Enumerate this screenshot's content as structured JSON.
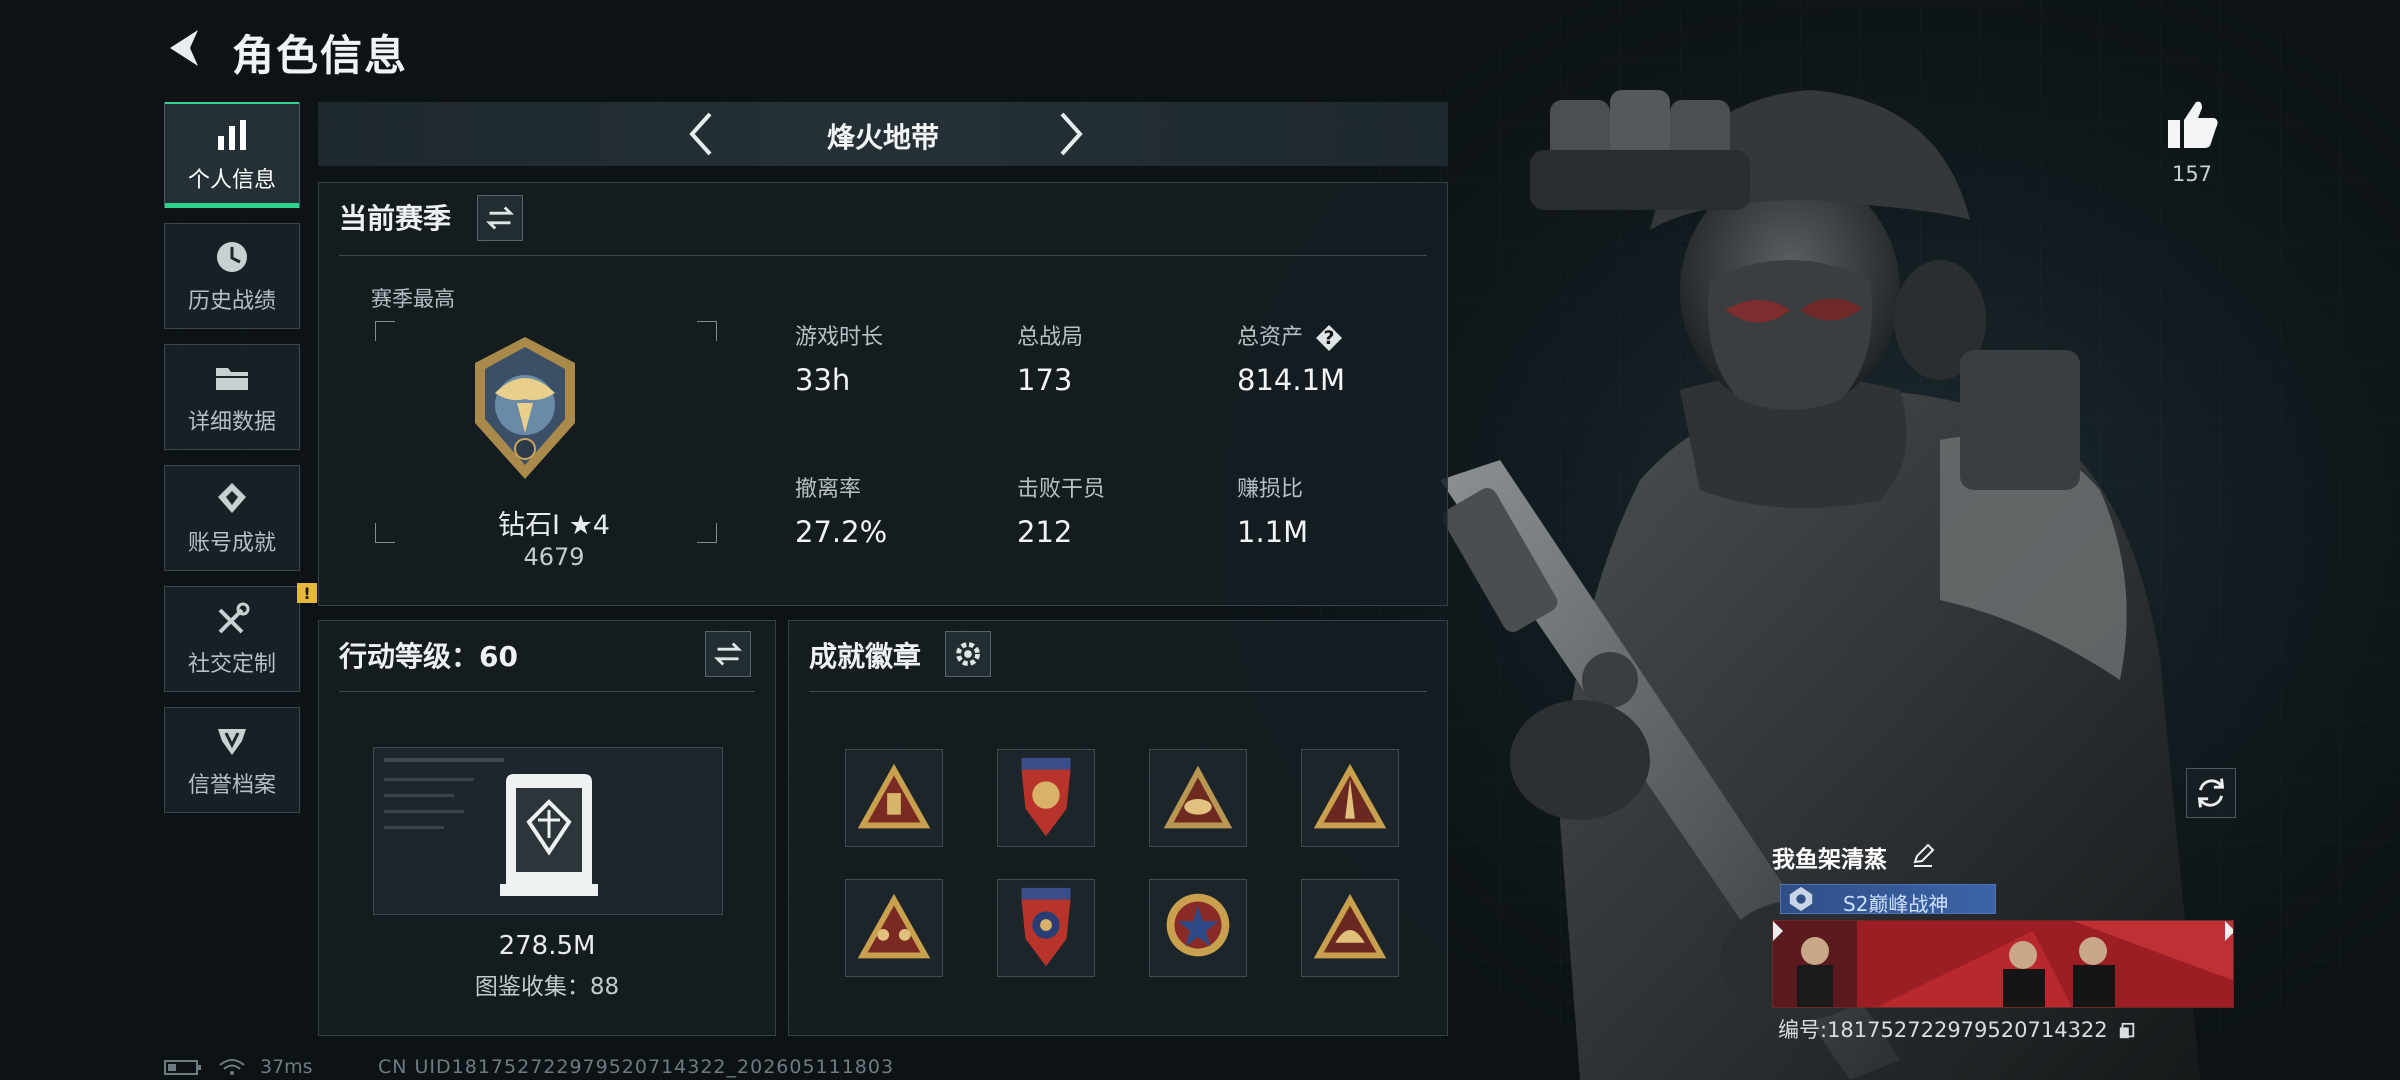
{
  "header": {
    "title": "角色信息"
  },
  "sidebar": {
    "items": [
      {
        "label": "个人信息",
        "icon": "bar-chart-icon",
        "active": true
      },
      {
        "label": "历史战绩",
        "icon": "clock-icon"
      },
      {
        "label": "详细数据",
        "icon": "folder-icon"
      },
      {
        "label": "账号成就",
        "icon": "diamond-icon"
      },
      {
        "label": "社交定制",
        "icon": "wrench-icon",
        "badge": "!"
      },
      {
        "label": "信誉档案",
        "icon": "shield-icon"
      }
    ]
  },
  "mode": {
    "title": "烽火地带"
  },
  "season": {
    "title": "当前赛季",
    "best_label": "赛季最高",
    "rank_name": "钻石I ★4",
    "rank_score": "4679",
    "stats": [
      {
        "label": "游戏时长",
        "value": "33h"
      },
      {
        "label": "总战局",
        "value": "173"
      },
      {
        "label": "总资产",
        "value": "814.1M"
      },
      {
        "label": "撤离率",
        "value": "27.2%"
      },
      {
        "label": "击败干员",
        "value": "212"
      },
      {
        "label": "赚损比",
        "value": "1.1M"
      }
    ],
    "help_mark": "?"
  },
  "action_level": {
    "title": "行动等级：60",
    "value": "278.5M",
    "collection_label": "图鉴收集：88"
  },
  "badges": {
    "title": "成就徽章",
    "items": [
      "triangle-medal-icon",
      "shield-crest-medal-icon",
      "eye-triangle-medal-icon",
      "spike-triangle-medal-icon",
      "figures-triangle-medal-icon",
      "star-shield-medal-icon",
      "round-star-medal-icon",
      "dome-triangle-medal-icon"
    ]
  },
  "likes": {
    "count": "157"
  },
  "profile": {
    "name": "我鱼架清蒸",
    "title_badge": "S2巅峰战神",
    "uid_text": "编号:18175272297952071432​2"
  },
  "footer": {
    "ping": "37ms",
    "uid": "CN UID18175272297952071432​2_20260511​1803"
  },
  "colors": {
    "accent": "#2fd18d",
    "badge_yellow": "#e5b83a",
    "title_blue": "#3c64a8"
  }
}
